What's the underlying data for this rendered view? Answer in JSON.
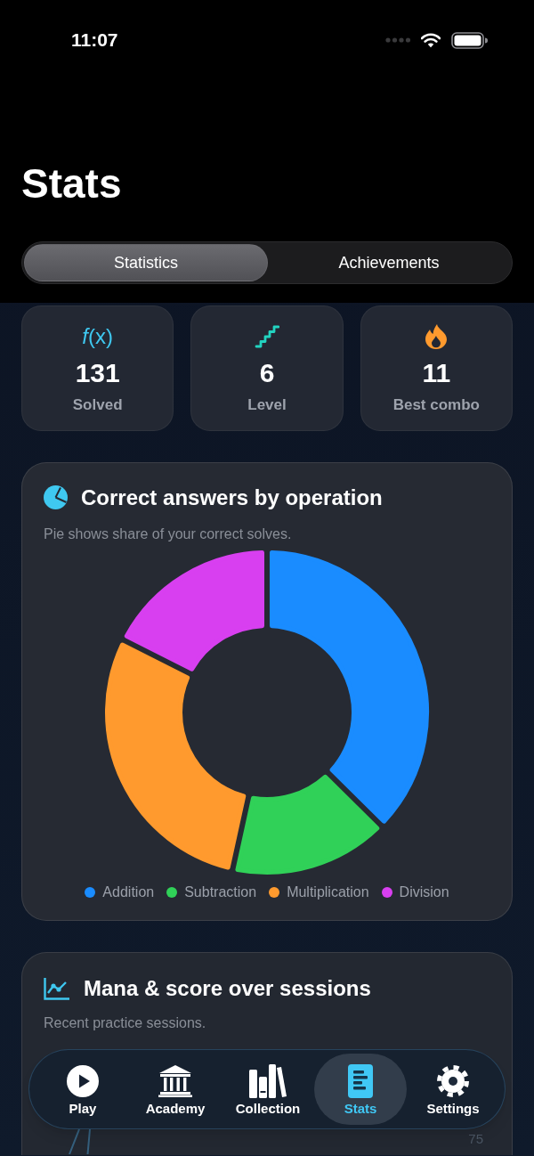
{
  "status_bar": {
    "time": "11:07"
  },
  "title": "Stats",
  "tabs": [
    {
      "label": "Statistics",
      "selected": true
    },
    {
      "label": "Achievements",
      "selected": false
    }
  ],
  "stat_cards": [
    {
      "kind": "solved",
      "symbol": "*f*(x)",
      "value": "131",
      "label": "Solved"
    },
    {
      "kind": "level",
      "value": "6",
      "label": "Level"
    },
    {
      "kind": "combo",
      "value": "11",
      "label": "Best combo"
    }
  ],
  "operations_card": {
    "title": "Correct answers by operation",
    "subtitle": "Pie shows share of your correct solves.",
    "legend": [
      {
        "label": "Addition",
        "color": "#1a8cff"
      },
      {
        "label": "Subtraction",
        "color": "#30d158"
      },
      {
        "label": "Multiplication",
        "color": "#ff9a2e"
      },
      {
        "label": "Division",
        "color": "#d83ff0"
      }
    ]
  },
  "sessions_card": {
    "title": "Mana & score over sessions",
    "subtitle": "Recent practice sessions.",
    "axis_label": "75"
  },
  "tab_bar": [
    {
      "kind": "play",
      "label": "Play",
      "selected": false
    },
    {
      "kind": "academy",
      "label": "Academy",
      "selected": false
    },
    {
      "kind": "collection",
      "label": "Collection",
      "selected": false
    },
    {
      "kind": "stats",
      "label": "Stats",
      "selected": true
    },
    {
      "kind": "settings",
      "label": "Settings",
      "selected": false
    }
  ]
}
